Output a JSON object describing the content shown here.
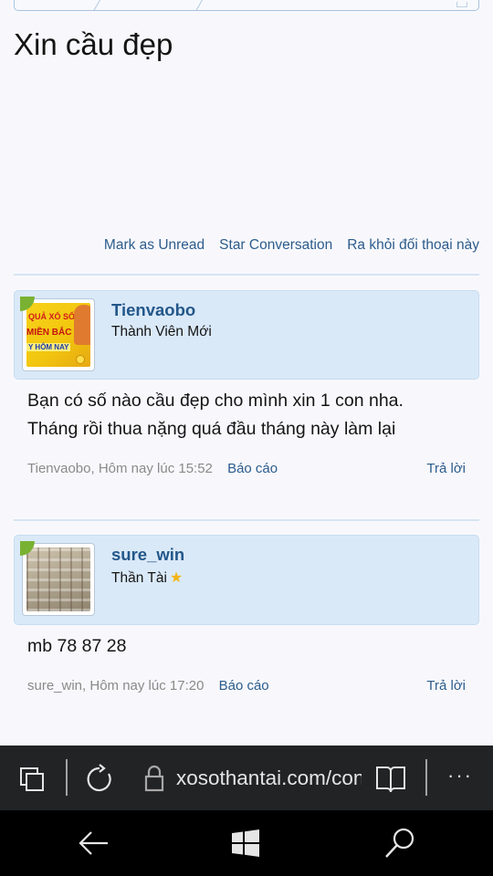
{
  "page": {
    "title": "Xin cầu đẹp"
  },
  "conversation_actions": {
    "mark_unread": "Mark as Unread",
    "star": "Star Conversation",
    "leave": "Ra khỏi đối thoại này"
  },
  "messages": [
    {
      "username": "Tienvaobo",
      "user_title": "Thành Viên Mới",
      "avatar_text": [
        "QUẢ XỔ SỐ",
        "MIỀN BẮC",
        "Y HÔM NAY"
      ],
      "body": "Bạn có số nào cầu đẹp cho mình xin 1 con nha.\nTháng rồi thua nặng quá đầu tháng này làm lại",
      "author_date": "Tienvaobo, Hôm nay lúc 15:52",
      "report": "Báo cáo",
      "reply": "Trả lời"
    },
    {
      "username": "sure_win",
      "user_title": "Thần Tài",
      "body": "mb 78 87 28",
      "author_date": "sure_win, Hôm nay lúc 17:20",
      "report": "Báo cáo",
      "reply": "Trả lời"
    }
  ],
  "browser": {
    "url": "xosothantai.com/conversations"
  },
  "colors": {
    "link": "#2c5c8c",
    "username": "#23578a",
    "header_bg": "#dae9f8",
    "bar_bg": "#222325"
  }
}
